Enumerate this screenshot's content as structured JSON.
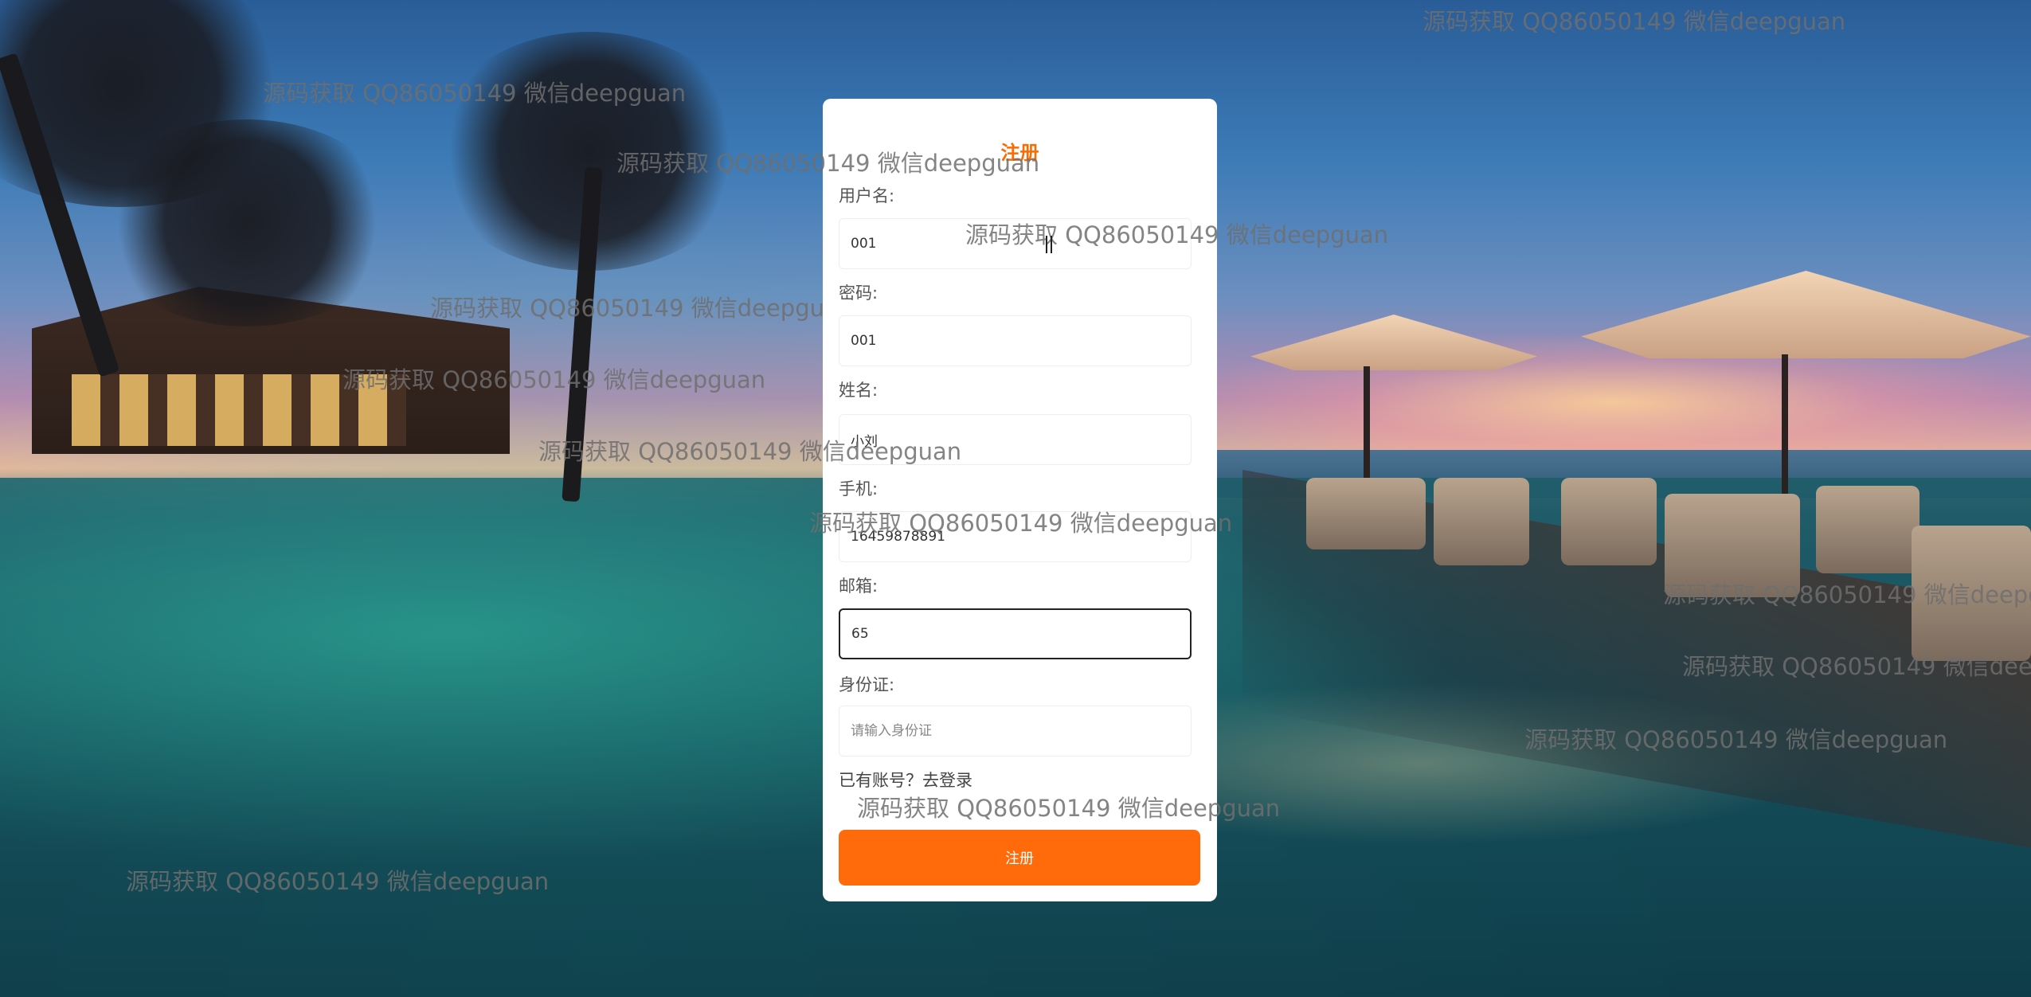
{
  "form": {
    "title": "注册",
    "fields": [
      {
        "label": "用户名:",
        "value": "001",
        "placeholder": "",
        "type": "text"
      },
      {
        "label": "密码:",
        "value": "001",
        "placeholder": "",
        "type": "text"
      },
      {
        "label": "姓名:",
        "value": "小刘",
        "placeholder": "",
        "type": "text"
      },
      {
        "label": "手机:",
        "value": "16459878891",
        "placeholder": "",
        "type": "text"
      },
      {
        "label": "邮箱:",
        "value": "65",
        "placeholder": "",
        "type": "text"
      },
      {
        "label": "身份证:",
        "value": "",
        "placeholder": "请输入身份证",
        "type": "text"
      }
    ],
    "login_link": "已有账号？去登录",
    "submit_label": "注册",
    "accent_color": "#ff6a00"
  },
  "watermark": {
    "text": "源码获取 QQ86050149 微信deepguan"
  },
  "cursor": {
    "icon": "text-cursor-icon"
  }
}
